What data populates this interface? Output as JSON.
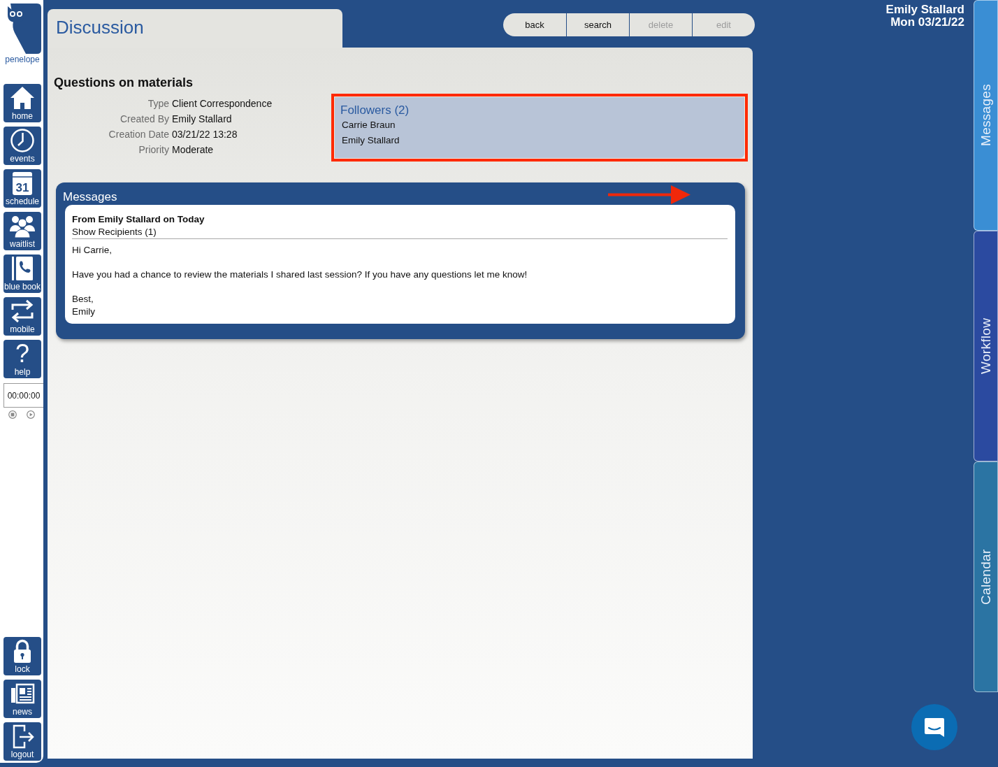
{
  "sidebar": {
    "logo": {
      "label": "penelope"
    },
    "nav_items": [
      {
        "label": "home"
      },
      {
        "label": "events"
      },
      {
        "label": "schedule",
        "icon_text": "31"
      },
      {
        "label": "waitlist"
      },
      {
        "label": "blue book"
      },
      {
        "label": "mobile"
      },
      {
        "label": "help",
        "icon_text": "?"
      }
    ],
    "timer": {
      "value": "00:00:00"
    },
    "bottom_items": [
      {
        "label": "lock"
      },
      {
        "label": "news"
      },
      {
        "label": "logout"
      }
    ]
  },
  "page": {
    "title": "Discussion"
  },
  "toolbar": [
    {
      "label": "back",
      "disabled": false
    },
    {
      "label": "search",
      "disabled": false
    },
    {
      "label": "delete",
      "disabled": true
    },
    {
      "label": "edit",
      "disabled": true
    }
  ],
  "user": {
    "name": "Emily Stallard",
    "date": "Mon 03/21/22"
  },
  "discussion": {
    "subject": "Questions on materials",
    "details": [
      {
        "label": "Type",
        "value": "Client Correspondence"
      },
      {
        "label": "Created By",
        "value": "Emily Stallard"
      },
      {
        "label": "Creation Date",
        "value": "03/21/22 13:28"
      },
      {
        "label": "Priority",
        "value": "Moderate"
      }
    ]
  },
  "followers": {
    "title": "Followers (2)",
    "names": [
      "Carrie Braun",
      "Emily Stallard"
    ]
  },
  "messages": {
    "title": "Messages",
    "items": [
      {
        "header": "From Emily Stallard on Today",
        "recipients": "Show Recipients (1)",
        "body": [
          "Hi Carrie,",
          "Have you had a chance to review the materials I shared last session? If you have any questions let me know!",
          "Best,\nEmily"
        ]
      }
    ]
  },
  "side_tabs": [
    {
      "label": "Messages",
      "color": "#3a8ed4"
    },
    {
      "label": "Workflow",
      "color": "#2b4aa0"
    },
    {
      "label": "Calendar",
      "color": "#2b74a3"
    }
  ]
}
